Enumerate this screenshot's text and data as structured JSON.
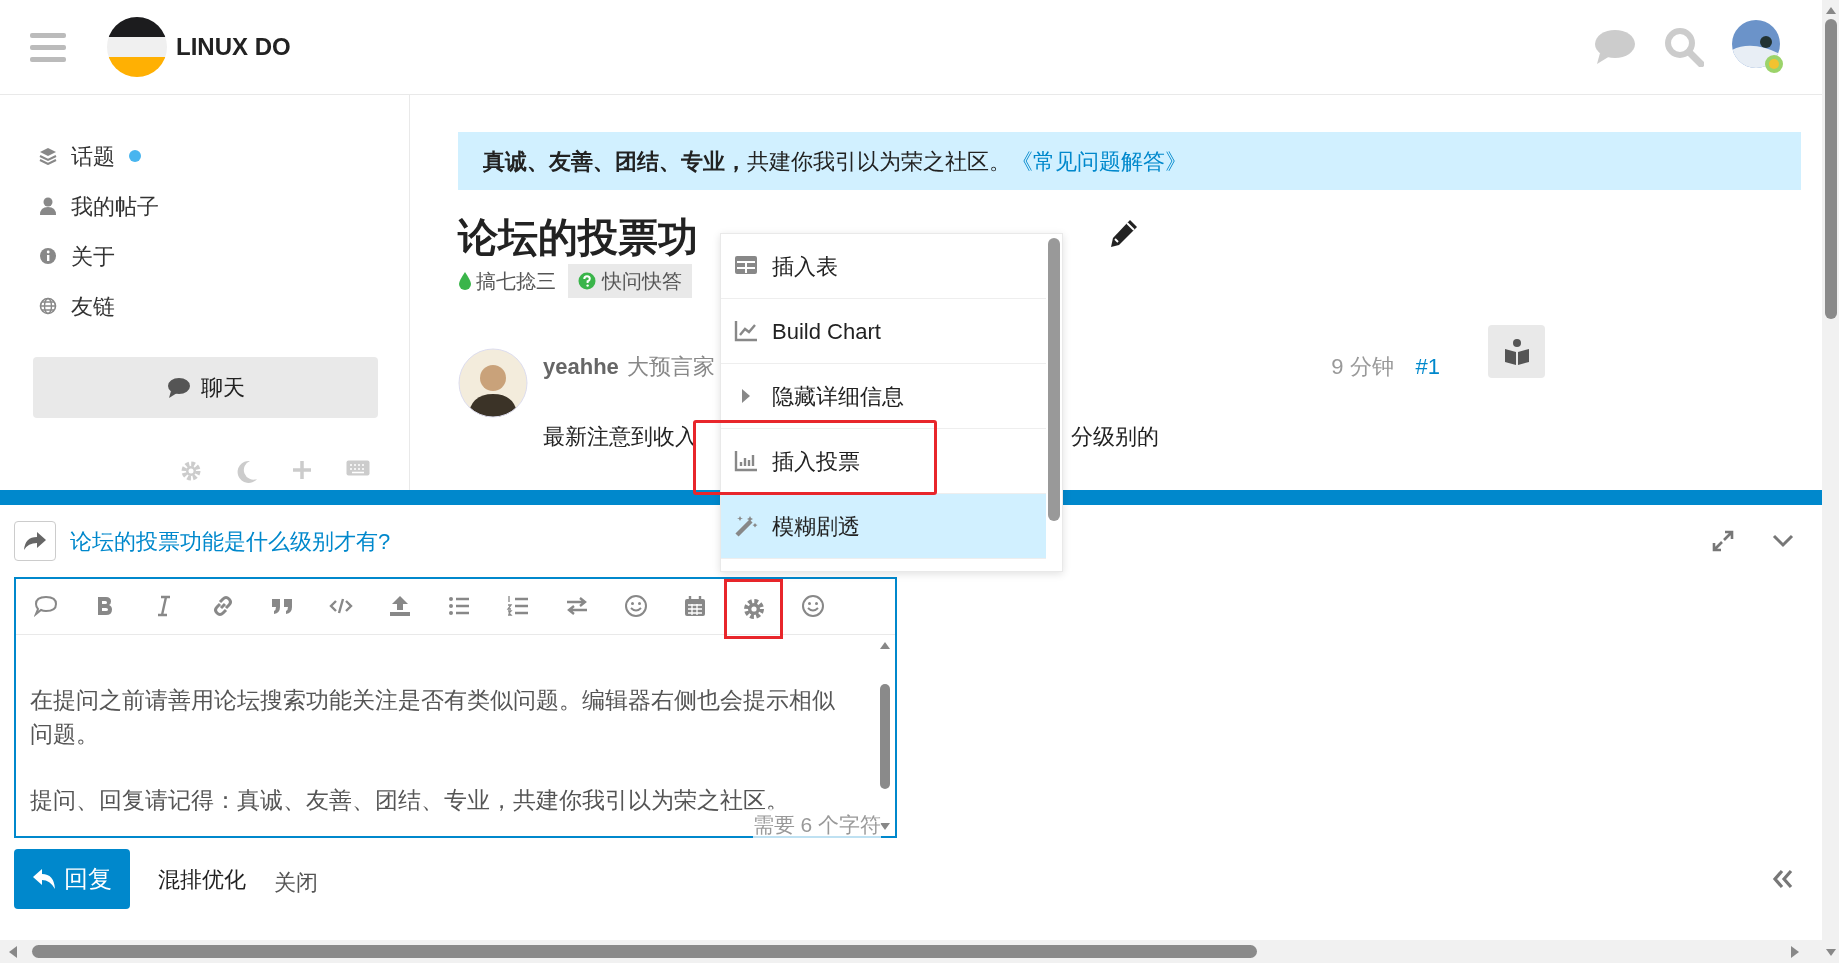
{
  "header": {
    "site_name": "LINUX DO"
  },
  "sidebar": {
    "items": [
      {
        "label": "话题",
        "unread": true
      },
      {
        "label": "我的帖子",
        "unread": false
      },
      {
        "label": "关于",
        "unread": false
      },
      {
        "label": "友链",
        "unread": false
      }
    ],
    "chat_button": "聊天"
  },
  "banner": {
    "text": "**真诚、友善、团结、专业，**共建你我引以为荣之社区。",
    "link": "《常见问题解答》"
  },
  "topic": {
    "title": "论坛的投票功",
    "category": "搞七捻三",
    "tag": "快问快答"
  },
  "post": {
    "username": "yeahhe",
    "user_title": "大预言家",
    "time": "9 分钟",
    "number": "#1",
    "body_left": "最新注意到收入",
    "body_right": "分级别的"
  },
  "composer": {
    "reply_to": "论坛的投票功能是什么级别才有?",
    "toolbar": [
      {
        "outlined": false
      },
      {
        "outlined": false
      },
      {
        "outlined": false
      },
      {
        "outlined": false
      },
      {
        "outlined": false
      },
      {
        "outlined": false
      },
      {
        "outlined": false
      },
      {
        "outlined": false
      },
      {
        "outlined": false
      },
      {
        "outlined": false
      },
      {
        "outlined": false
      },
      {
        "outlined": false
      },
      {
        "outlined": true
      },
      {
        "outlined": false
      }
    ],
    "paragraphs": [
      "在提问之前请善用论坛搜索功能关注是否有类似问题。编辑器右侧也会提示相似问题。",
      "提问、回复请记得：真诚、友善、团结、专业，共建你我引以为荣之社区。"
    ],
    "char_hint": "需要 6 个字符",
    "submit": "回复",
    "secondary": [
      "混排优化",
      "关闭"
    ]
  },
  "popup_menu": {
    "items": [
      {
        "label": "插入表",
        "selected": false,
        "outlined": false
      },
      {
        "label": "Build Chart",
        "selected": false,
        "outlined": false
      },
      {
        "label": "隐藏详细信息",
        "selected": false,
        "outlined": false
      },
      {
        "label": "插入投票",
        "selected": false,
        "outlined": true
      },
      {
        "label": "模糊剧透",
        "selected": true,
        "outlined": false
      }
    ]
  }
}
